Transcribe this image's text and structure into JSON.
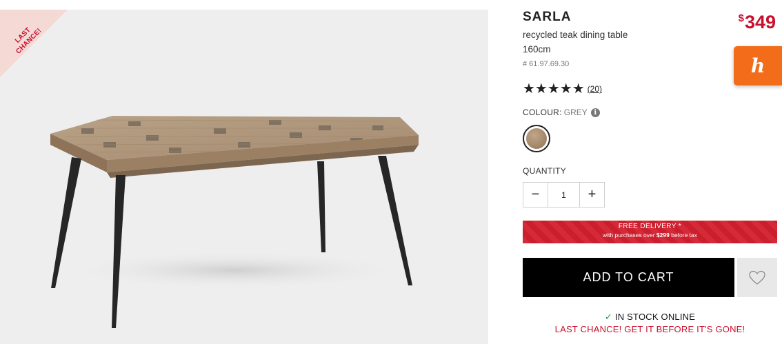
{
  "product": {
    "badge_line1": "LAST",
    "badge_line2": "CHANCE!",
    "name": "SARLA",
    "description_line1": "recycled teak dining table",
    "description_line2": "160cm",
    "sku": "# 61.97.69.30",
    "price_currency": "$",
    "price_amount": "349",
    "rating_stars": "★★★★★",
    "rating_value": 5,
    "review_count": "(20)"
  },
  "honey": {
    "icon": "honey-extension-icon",
    "glyph": "h",
    "color": "#f26c1a"
  },
  "colour": {
    "label": "COLOUR:",
    "value": "GREY",
    "info_glyph": "i"
  },
  "quantity": {
    "label": "QUANTITY",
    "minus": "−",
    "value": "1",
    "plus": "+"
  },
  "delivery": {
    "line1": "FREE DELIVERY *",
    "line2_prefix": "with purchases over",
    "line2_amount": "$299",
    "line2_suffix": "before tax",
    "color": "#d21f2e"
  },
  "cart": {
    "add_label": "ADD TO CART",
    "wishlist_icon": "heart-icon"
  },
  "stock": {
    "check_glyph": "✓",
    "status": "IN STOCK ONLINE",
    "last_chance": "LAST CHANCE! GET IT BEFORE IT'S GONE!"
  },
  "colors": {
    "accent": "#c8102e",
    "button": "#000000"
  }
}
